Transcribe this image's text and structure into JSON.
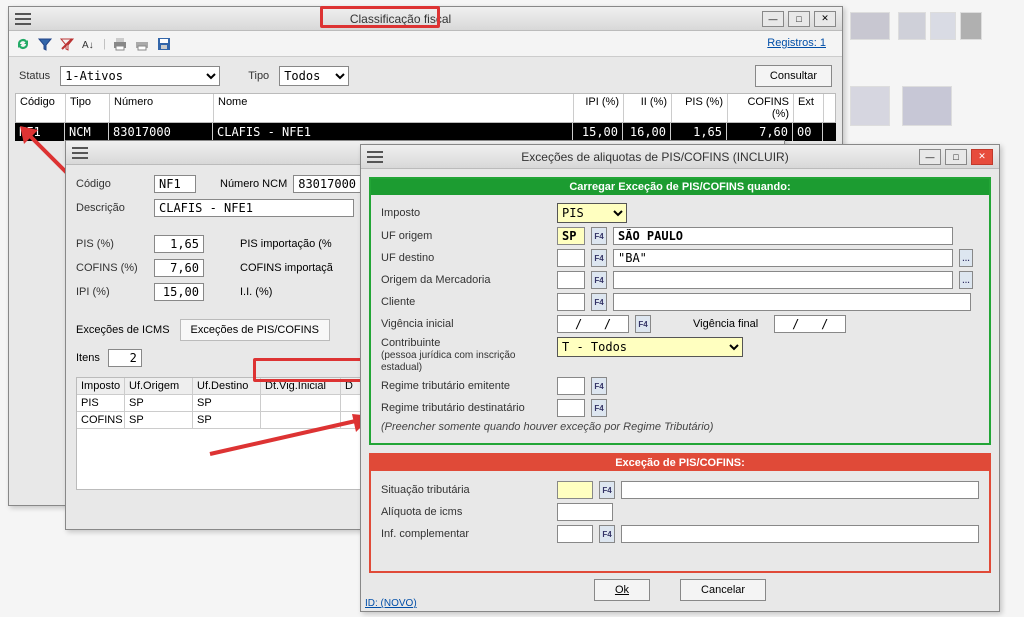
{
  "win1": {
    "title": "Classificação fiscal",
    "registros": "Registros: 1",
    "status_label": "Status",
    "status_value": "1-Ativos",
    "tipo_label": "Tipo",
    "tipo_value": "Todos",
    "consultar": "Consultar",
    "columns": {
      "codigo": "Código",
      "tipo": "Tipo",
      "numero": "Número",
      "nome": "Nome",
      "ipi": "IPI (%)",
      "ii": "II (%)",
      "pis": "PIS (%)",
      "cofins": "COFINS (%)",
      "ext": "Ext"
    },
    "row": {
      "codigo": "NF1",
      "tipo": "NCM",
      "numero": "83017000",
      "nome": "CLAFIS - NFE1",
      "ipi": "15,00",
      "ii": "16,00",
      "pis": "1,65",
      "cofins": "7,60",
      "ext": "00"
    }
  },
  "win2": {
    "codigo_label": "Código",
    "codigo": "NF1",
    "ncm_label": "Número NCM",
    "ncm": "83017000",
    "descricao_label": "Descrição",
    "descricao": "CLAFIS - NFE1",
    "pis_label": "PIS (%)",
    "pis": "1,65",
    "pisimp_label": "PIS importação (%",
    "cofins_label": "COFINS (%)",
    "cofins": "7,60",
    "cofinsimp_label": "COFINS importaçã",
    "ipi_label": "IPI (%)",
    "ipi": "15,00",
    "ii_label": "I.I. (%)",
    "tab_icms": "Exceções de ICMS",
    "tab_piscofins": "Exceções de PIS/COFINS",
    "itens_label": "Itens",
    "itens": "2",
    "ihdr": {
      "imposto": "Imposto",
      "ufo": "Uf.Origem",
      "ufd": "Uf.Destino",
      "dtv": "Dt.Vig.Inicial",
      "ext": "D"
    },
    "irow1": {
      "imposto": "PIS",
      "ufo": "SP",
      "ufd": "SP"
    },
    "irow2": {
      "imposto": "COFINS",
      "ufo": "SP",
      "ufd": "SP"
    }
  },
  "win3": {
    "title": "Exceções de aliquotas de PIS/COFINS (INCLUIR)",
    "panel1_title": "Carregar Exceção de PIS/COFINS quando:",
    "imposto_label": "Imposto",
    "imposto": "PIS",
    "ufo_label": "UF origem",
    "ufo_code": "SP",
    "ufo_name": "SÃO PAULO",
    "ufd_label": "UF destino",
    "ufd_name": "\"BA\"",
    "orimerc_label": "Origem da Mercadoria",
    "cliente_label": "Cliente",
    "vigini_label": "Vigência inicial",
    "vigini": "/   /",
    "vigfim_label": "Vigência final",
    "vigfim": "/   /",
    "contrib_label": "Contribuinte",
    "contrib_sub": "(pessoa jurídica com inscrição estadual)",
    "contrib": "T - Todos",
    "regemi_label": "Regime tributário emitente",
    "regdest_label": "Regime tributário destinatário",
    "note": "(Preencher somente quando houver exceção por Regime Tributário)",
    "panel2_title": "Exceção de PIS/COFINS:",
    "sittrib_label": "Situação tributária",
    "aliqicms_label": "Alíquota de icms",
    "infcompl_label": "Inf. complementar",
    "ok": "Ok",
    "cancelar": "Cancelar",
    "id": "ID: (NOVO)"
  }
}
